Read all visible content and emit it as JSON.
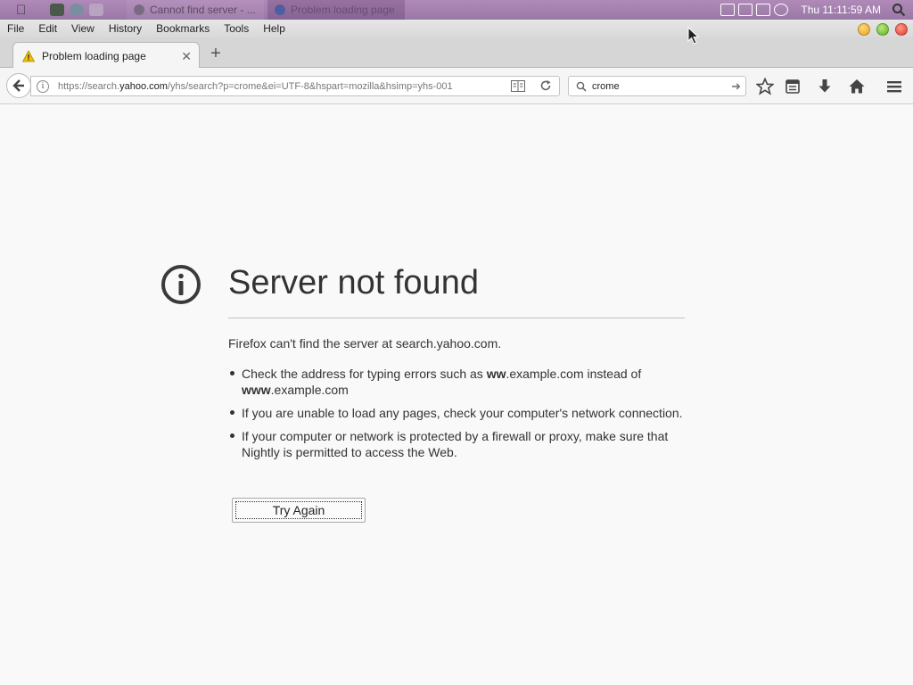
{
  "system_panel": {
    "tasks": [
      {
        "label": "Cannot find server - ..."
      },
      {
        "label": "Problem loading page"
      }
    ],
    "clock": "Thu 11:11:59 AM"
  },
  "menubar": {
    "items": [
      "File",
      "Edit",
      "View",
      "History",
      "Bookmarks",
      "Tools",
      "Help"
    ]
  },
  "tabs": {
    "active": {
      "label": "Problem loading page"
    },
    "new_tab": "+"
  },
  "nav": {
    "url_prefix": "https://search.",
    "url_host": "yahoo.com",
    "url_suffix": "/yhs/search?p=crome&ei=UTF-8&hspart=mozilla&hsimp=yhs-001",
    "search_value": "crome"
  },
  "error_page": {
    "title": "Server not found",
    "message": "Firefox can't find the server at search.yahoo.com.",
    "tip1_a": "Check the address for typing errors such as ",
    "tip1_b": "ww",
    "tip1_c": ".example.com instead of ",
    "tip1_d": "www",
    "tip1_e": ".example.com",
    "tip2": "If you are unable to load any pages, check your computer's network connection.",
    "tip3": "If your computer or network is protected by a firewall or proxy, make sure that Nightly is permitted to access the Web.",
    "button": "Try Again"
  },
  "colors": {
    "panel": "#9a78a6",
    "page_bg": "#f9f9fa",
    "warning": "#f0c000"
  }
}
